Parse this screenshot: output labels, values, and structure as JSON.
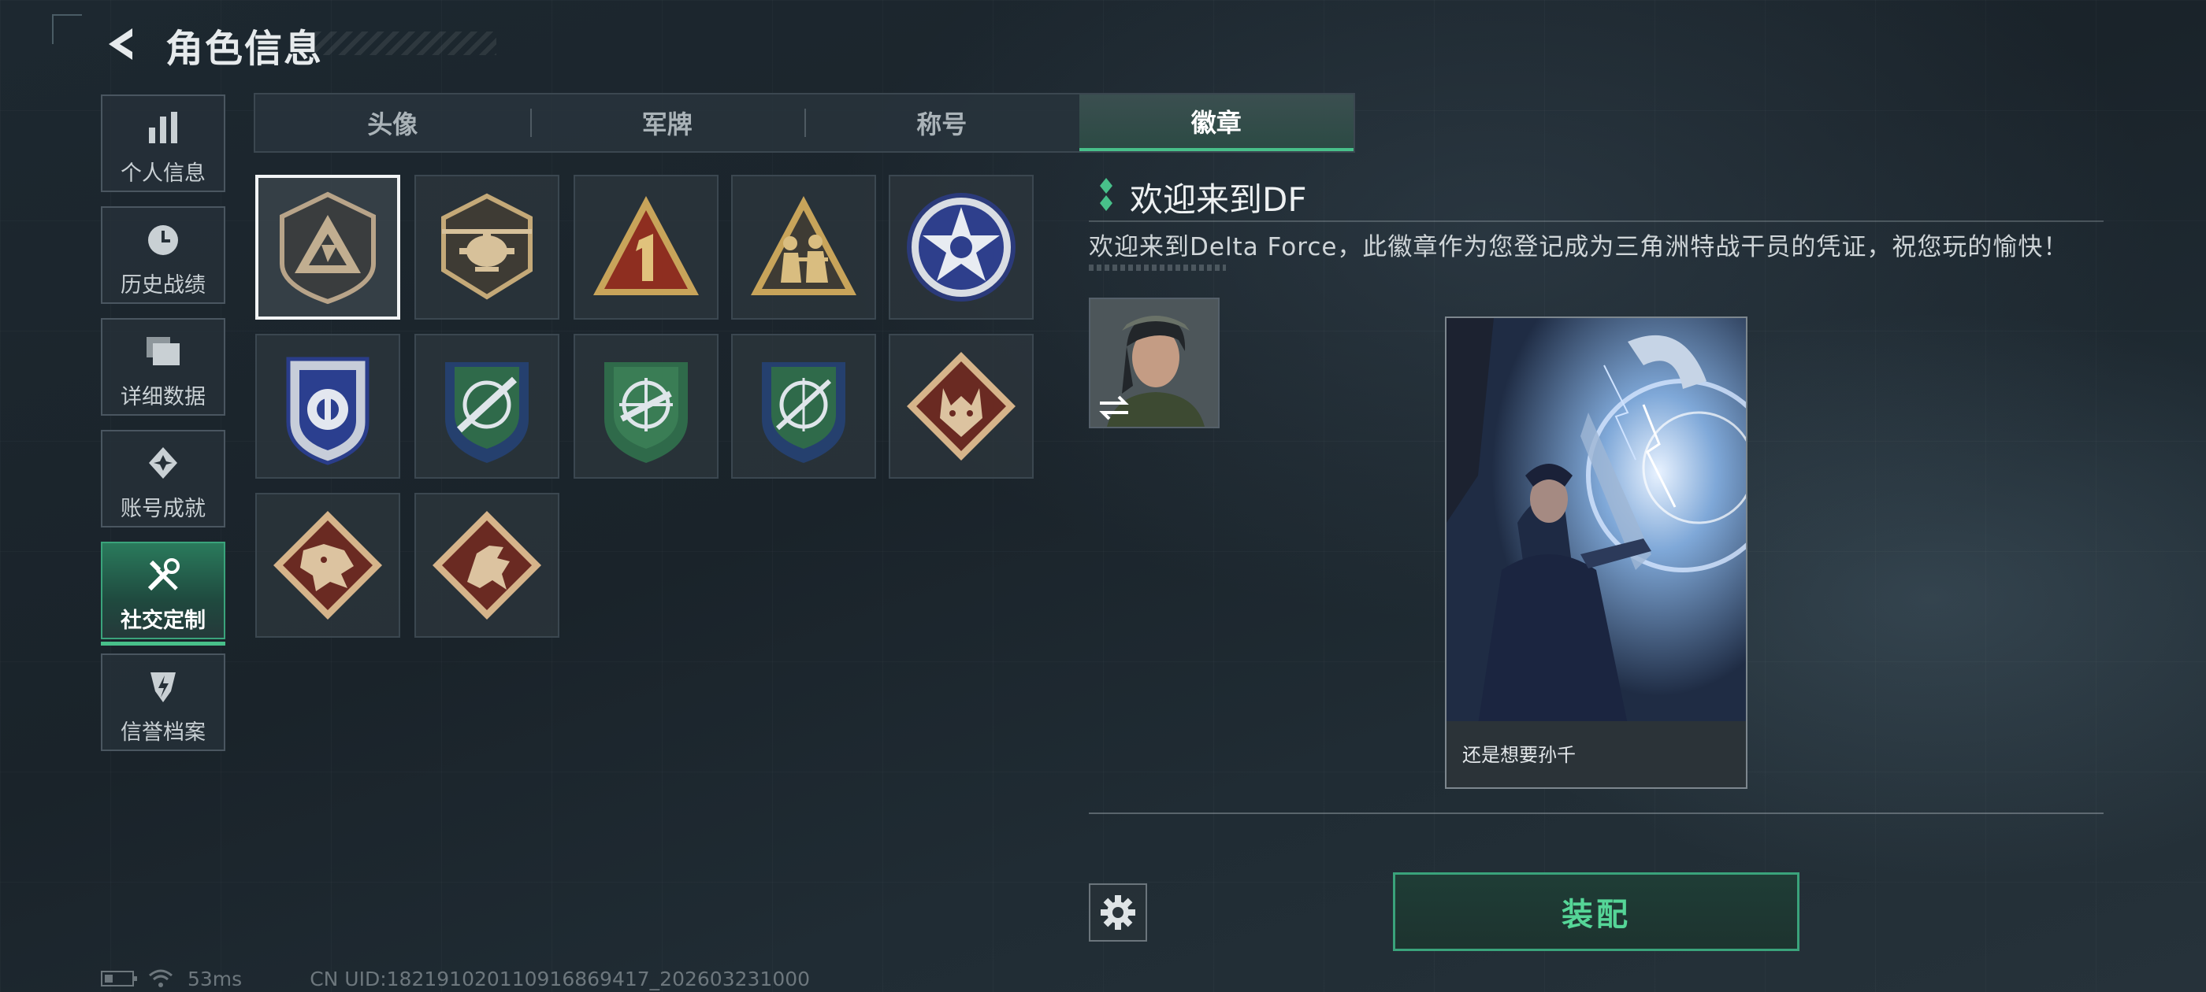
{
  "header": {
    "title": "角色信息"
  },
  "sidebar": {
    "items": [
      {
        "label": "个人信息",
        "icon": "bar-chart-icon"
      },
      {
        "label": "历史战绩",
        "icon": "clock-icon"
      },
      {
        "label": "详细数据",
        "icon": "folder-icon"
      },
      {
        "label": "账号成就",
        "icon": "achievement-icon"
      },
      {
        "label": "社交定制",
        "icon": "tools-icon",
        "active": true
      },
      {
        "label": "信誉档案",
        "icon": "shield-bolt-icon"
      }
    ]
  },
  "tabs": [
    {
      "label": "头像"
    },
    {
      "label": "军牌"
    },
    {
      "label": "称号"
    },
    {
      "label": "徽章",
      "active": true
    }
  ],
  "badges": [
    {
      "name": "delta-triangle-badge",
      "selected": true
    },
    {
      "name": "helicopter-badge"
    },
    {
      "name": "number-one-badge"
    },
    {
      "name": "soldiers-badge"
    },
    {
      "name": "star-emblem-badge"
    },
    {
      "name": "blue-shield-badge"
    },
    {
      "name": "green-blue-rifle-badge"
    },
    {
      "name": "green-crosshair-badge"
    },
    {
      "name": "blue-sniper-badge"
    },
    {
      "name": "wolf-badge"
    },
    {
      "name": "dragon-badge"
    },
    {
      "name": "gryphon-badge"
    }
  ],
  "detail": {
    "title": "欢迎来到DF",
    "description": "欢迎来到Delta Force，此徽章作为您登记成为三角洲特战干员的凭证，祝您玩的愉快！",
    "card_caption": "还是想要孙千"
  },
  "actions": {
    "equip_label": "装配"
  },
  "status": {
    "ping": "53ms",
    "uid": "CN UID:18219102011091686941​7_202603231000"
  },
  "colors": {
    "accent": "#48c08a",
    "equip_text": "#55d597"
  }
}
